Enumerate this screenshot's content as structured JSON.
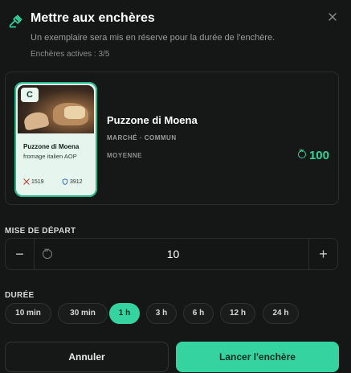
{
  "header": {
    "title": "Mettre aux enchères",
    "subtitle": "Un exemplaire sera mis en réserve pour la durée de l'enchère.",
    "icon": "gavel-icon",
    "close_icon": "close-icon"
  },
  "active_auctions": "Enchères actives : 3/5",
  "card": {
    "rarity_badge": "C",
    "name": "Puzzone di Moena",
    "description": "fromage italien AOP",
    "stat_attack": "1519",
    "stat_defense": "3912",
    "attack_icon": "swords-icon",
    "defense_icon": "shield-icon"
  },
  "item": {
    "name": "Puzzone di Moena",
    "meta": "MARCHÉ · COMMUN",
    "tier": "MOYENNE",
    "price": "100",
    "price_icon": "coin-icon"
  },
  "starting_bid": {
    "label": "MISE DE DÉPART",
    "value": "10",
    "minus": "−",
    "plus": "+"
  },
  "duration": {
    "label": "DURÉE",
    "options": [
      "10 min",
      "30 min",
      "1 h",
      "3 h",
      "6 h",
      "12 h",
      "24 h"
    ],
    "selected": "1 h"
  },
  "actions": {
    "cancel": "Annuler",
    "launch": "Lancer l'enchère"
  },
  "colors": {
    "accent": "#35d39f",
    "price": "#2ed49a",
    "background": "#151716"
  }
}
